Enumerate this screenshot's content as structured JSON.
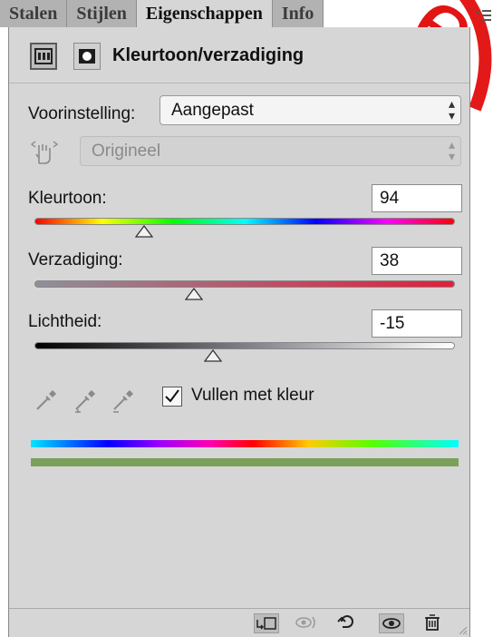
{
  "tabs": [
    {
      "label": "Stalen"
    },
    {
      "label": "Stijlen"
    },
    {
      "label": "Eigenschappen",
      "active": true
    },
    {
      "label": "Info"
    }
  ],
  "header": {
    "title": "Kleurtoon/verzadiging"
  },
  "preset": {
    "label": "Voorinstelling:",
    "value": "Aangepast"
  },
  "channel": {
    "value": "Origineel"
  },
  "hue": {
    "label": "Kleurtoon:",
    "value": "94",
    "slider_fraction": 0.26
  },
  "saturation": {
    "label": "Verzadiging:",
    "value": "38",
    "slider_fraction": 0.38
  },
  "lightness": {
    "label": "Lichtheid:",
    "value": "-15",
    "slider_fraction": 0.425
  },
  "colorize": {
    "label": "Vullen met kleur",
    "checked": true
  },
  "icons": {
    "target_adjustment": "hand-target-icon",
    "eyedropper": "eyedropper-icon",
    "eyedropper_add": "eyedropper-plus-icon",
    "eyedropper_subtract": "eyedropper-minus-icon",
    "clip_to_layer": "clip-to-layer-icon",
    "view_previous": "view-previous-icon",
    "reset": "reset-icon",
    "visibility": "eye-icon",
    "delete": "trash-icon"
  },
  "colors": {
    "result_bar": "#7aa05a",
    "watermark": "#e00000"
  }
}
